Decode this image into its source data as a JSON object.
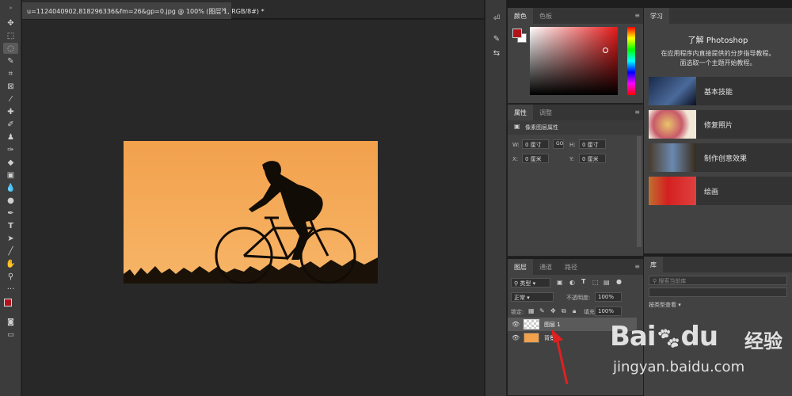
{
  "document": {
    "tab_title": "u=1124040902,818296336&fm=26&gp=0.jpg @ 100% (图层 1, RGB/8#) *",
    "close_label": "×"
  },
  "tools": [
    "move-icon",
    "marquee-icon",
    "lasso-icon",
    "quick-select-icon",
    "crop-icon",
    "frame-icon",
    "eyedropper-icon",
    "healing-icon",
    "brush-icon",
    "stamp-icon",
    "history-brush-icon",
    "eraser-icon",
    "gradient-icon",
    "blur-icon",
    "dodge-icon",
    "pen-icon",
    "type-icon",
    "path-select-icon",
    "line-icon",
    "hand-icon",
    "zoom-icon",
    "more-icon"
  ],
  "color_panel": {
    "tabs": [
      "颜色",
      "色板"
    ],
    "foreground": "#b3121b",
    "background": "#ffffff",
    "hue": "#e81a1a"
  },
  "properties_panel": {
    "tabs": [
      "属性",
      "调整"
    ],
    "header": "像素图层属性",
    "w_label": "W:",
    "w_value": "0 厘寸",
    "h_label": "H:",
    "h_value": "0 厘寸",
    "x_label": "X:",
    "x_value": "0 厘米",
    "y_label": "Y:",
    "y_value": "0 厘米",
    "link_label": "GO"
  },
  "layers_panel": {
    "tabs": [
      "图层",
      "通道",
      "路径"
    ],
    "filter_kind": "类型",
    "blend_mode": "正常",
    "opacity_label": "不透明度:",
    "opacity_value": "100%",
    "lock_label": "锁定:",
    "fill_label": "填充:",
    "fill_value": "100%",
    "layers": [
      {
        "name": "图层 1",
        "selected": true
      },
      {
        "name": "背景",
        "selected": false
      }
    ]
  },
  "learn_panel": {
    "tab": "学习",
    "title": "了解 Photoshop",
    "desc_line1": "在应用程序内直接提供的分步指导教程。",
    "desc_line2": "面选取一个主题开始教程。",
    "lessons": [
      "基本技能",
      "修复照片",
      "制作创意效果",
      "绘画"
    ]
  },
  "libraries_panel": {
    "tab": "库",
    "search_placeholder": "搜索当前库",
    "view_label": "按类型查看"
  },
  "watermark": {
    "brand": "Bai",
    "brand2": "du",
    "jingyan": "经验",
    "url": "jingyan.baidu.com"
  }
}
